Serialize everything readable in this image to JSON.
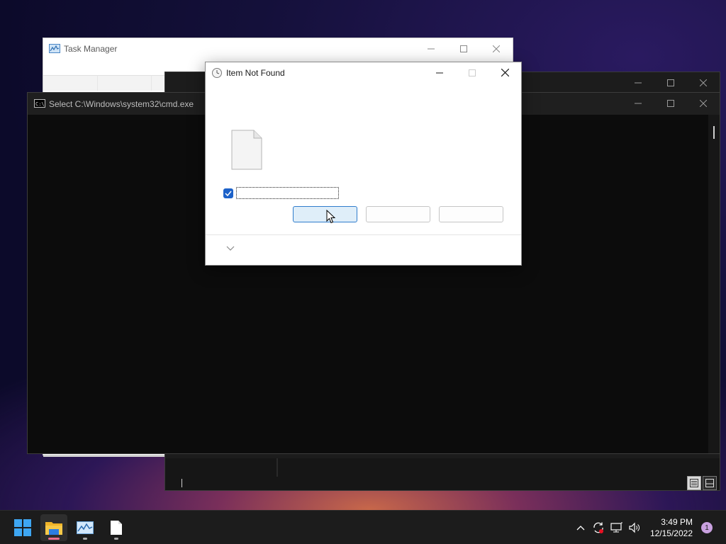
{
  "task_manager": {
    "title": "Task Manager"
  },
  "cmd": {
    "title": "Select C:\\Windows\\system32\\cmd.exe"
  },
  "dialog": {
    "title": "Item Not Found",
    "checkbox_checked": true,
    "checkbox_label": "",
    "buttons": [
      "",
      "",
      ""
    ]
  },
  "taskbar": {
    "apps": [
      {
        "name": "start",
        "icon": "windows-logo-icon"
      },
      {
        "name": "file-explorer",
        "icon": "folder-icon",
        "active": true
      },
      {
        "name": "task-manager",
        "icon": "task-manager-icon"
      },
      {
        "name": "notepad",
        "icon": "document-icon"
      }
    ],
    "clock_time": "3:49 PM",
    "clock_date": "12/15/2022",
    "notification_count": "1"
  },
  "colors": {
    "accent": "#1d62c9",
    "taskbar": "#1c1c1c",
    "console_bg": "#0c0c0c"
  }
}
